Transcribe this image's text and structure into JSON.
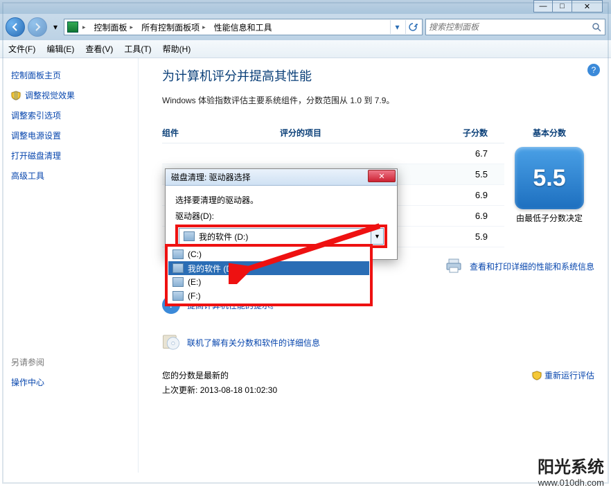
{
  "breadcrumb": {
    "a": "控制面板",
    "b": "所有控制面板项",
    "c": "性能信息和工具"
  },
  "search": {
    "placeholder": "搜索控制面板"
  },
  "menu": {
    "file": "文件(F)",
    "edit": "编辑(E)",
    "view": "查看(V)",
    "tools": "工具(T)",
    "help": "帮助(H)"
  },
  "sidebar": {
    "items": [
      "控制面板主页",
      "调整视觉效果",
      "调整索引选项",
      "调整电源设置",
      "打开磁盘清理",
      "高级工具"
    ],
    "seealso_header": "另请参阅",
    "seealso": [
      "操作中心"
    ]
  },
  "page": {
    "title": "为计算机评分并提高其性能",
    "desc": "Windows 体验指数评估主要系统组件，分数范围从 1.0 到 7.9。"
  },
  "table": {
    "h_component": "组件",
    "h_item": "评分的项目",
    "h_sub": "子分数",
    "h_base": "基本分数",
    "rows": [
      {
        "sub": "6.7"
      },
      {
        "sub": "5.5",
        "hl": true
      },
      {
        "sub": "6.9"
      },
      {
        "sub": "6.9"
      },
      {
        "sub": "5.9"
      }
    ],
    "big": "5.5",
    "big_caption": "由最低子分数决定"
  },
  "links": {
    "print": "查看和打印详细的性能和系统信息",
    "tips": "提高计算机性能的提示。",
    "online": "联机了解有关分数和软件的详细信息"
  },
  "status": {
    "line1": "您的分数是最新的",
    "line2_label": "上次更新:",
    "line2_value": "2013-08-18 01:02:30",
    "rerun": "重新运行评估"
  },
  "dialog": {
    "title": "磁盘清理: 驱动器选择",
    "label": "选择要清理的驱动器。",
    "drives_label": "驱动器(D):",
    "selected": "我的软件 (D:)",
    "options": [
      {
        "label": "(C:)"
      },
      {
        "label": "我的软件 (D:)",
        "selected": true
      },
      {
        "label": "(E:)"
      },
      {
        "label": "(F:)"
      }
    ]
  },
  "watermark": {
    "main": "阳光系统",
    "url": "www.010dh.com"
  }
}
